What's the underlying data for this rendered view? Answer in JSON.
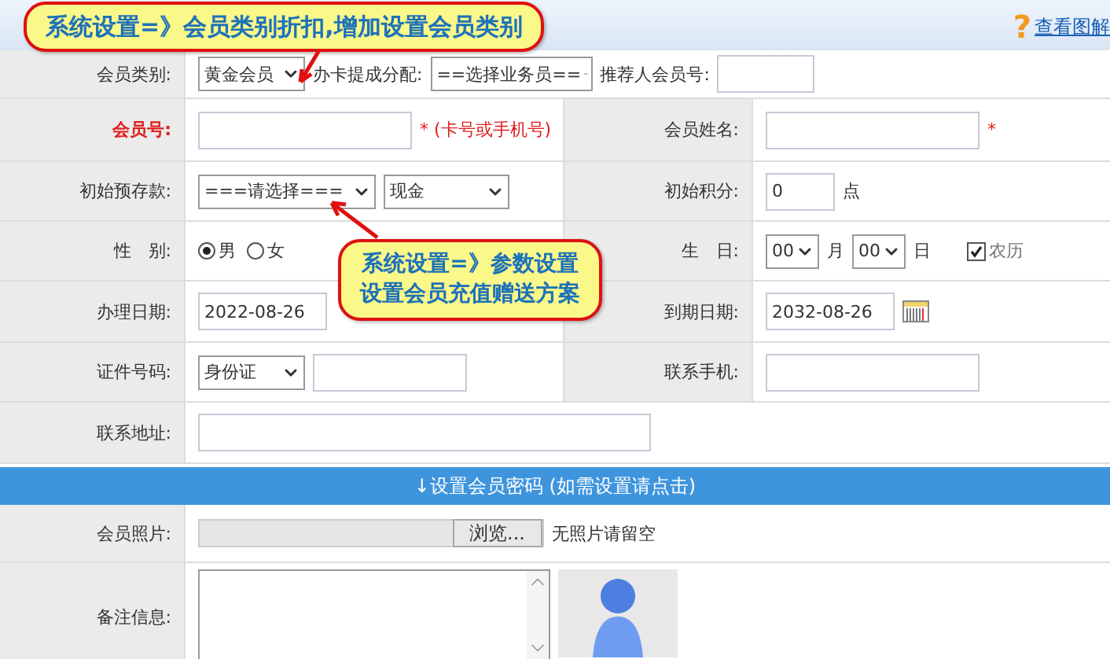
{
  "header": {
    "help_icon": "?",
    "help_link": "查看图解"
  },
  "rows": [
    {
      "cells": [
        {
          "label": "会员类别:",
          "highlighted": false,
          "controls": [
            {
              "kind": "select",
              "value": "黄金会员"
            },
            {
              "kind": "text",
              "text": "办卡提成分配:"
            },
            {
              "kind": "select",
              "value": "==选择业务员=="
            },
            {
              "kind": "text",
              "text": "推荐人会员号:"
            },
            {
              "kind": "input"
            }
          ]
        }
      ]
    },
    {
      "cells": [
        {
          "label": "会员号:",
          "highlighted": true,
          "controls": [
            {
              "kind": "input"
            },
            {
              "kind": "note",
              "text": "* (卡号或手机号)"
            }
          ]
        },
        {
          "label": "会员姓名:",
          "highlighted": false,
          "controls": [
            {
              "kind": "input"
            },
            {
              "kind": "note",
              "text": "*"
            }
          ]
        }
      ]
    },
    {
      "cells": [
        {
          "label": "初始预存款:",
          "highlighted": false,
          "controls": [
            {
              "kind": "select",
              "value": "===请选择==="
            },
            {
              "kind": "select",
              "value": "现金"
            }
          ]
        },
        {
          "label": "初始积分:",
          "highlighted": false,
          "controls": [
            {
              "kind": "input",
              "value": "0"
            },
            {
              "kind": "text",
              "text": "点"
            }
          ]
        }
      ]
    },
    {
      "cells": [
        {
          "label": "性　别:",
          "highlighted": false,
          "controls": [
            {
              "kind": "radio",
              "label": "男",
              "selected": true
            },
            {
              "kind": "radio",
              "label": "女",
              "selected": false
            }
          ]
        },
        {
          "label": "生　日:",
          "highlighted": false,
          "controls": [
            {
              "kind": "select",
              "value": "00"
            },
            {
              "kind": "text",
              "text": "月"
            },
            {
              "kind": "select",
              "value": "00"
            },
            {
              "kind": "text",
              "text": "日"
            },
            {
              "kind": "checkbox",
              "label": "农历",
              "checked": true
            }
          ]
        }
      ]
    },
    {
      "cells": [
        {
          "label": "办理日期:",
          "highlighted": false,
          "controls": [
            {
              "kind": "input",
              "value": "2022-08-26"
            }
          ]
        },
        {
          "label": "到期日期:",
          "highlighted": false,
          "controls": [
            {
              "kind": "input",
              "value": "2032-08-26"
            },
            {
              "kind": "calendar"
            }
          ]
        }
      ]
    },
    {
      "cells": [
        {
          "label": "证件号码:",
          "highlighted": false,
          "controls": [
            {
              "kind": "select",
              "value": "身份证"
            },
            {
              "kind": "input"
            }
          ]
        },
        {
          "label": "联系手机:",
          "highlighted": false,
          "controls": [
            {
              "kind": "input"
            }
          ]
        }
      ]
    },
    {
      "cells": [
        {
          "label": "联系地址:",
          "highlighted": false,
          "controls": [
            {
              "kind": "input"
            }
          ]
        }
      ]
    }
  ],
  "password_bar": "↓设置会员密码 (如需设置请点击)",
  "photo": {
    "label": "会员照片:",
    "button": "浏览...",
    "hint": "无照片请留空"
  },
  "notes": {
    "label": "备注信息:"
  },
  "callouts": [
    {
      "lines": [
        "系统设置=》会员类别折扣,增加设置会员类别"
      ]
    },
    {
      "lines": [
        "系统设置=》参数设置",
        "设置会员充值赠送方案"
      ]
    }
  ]
}
